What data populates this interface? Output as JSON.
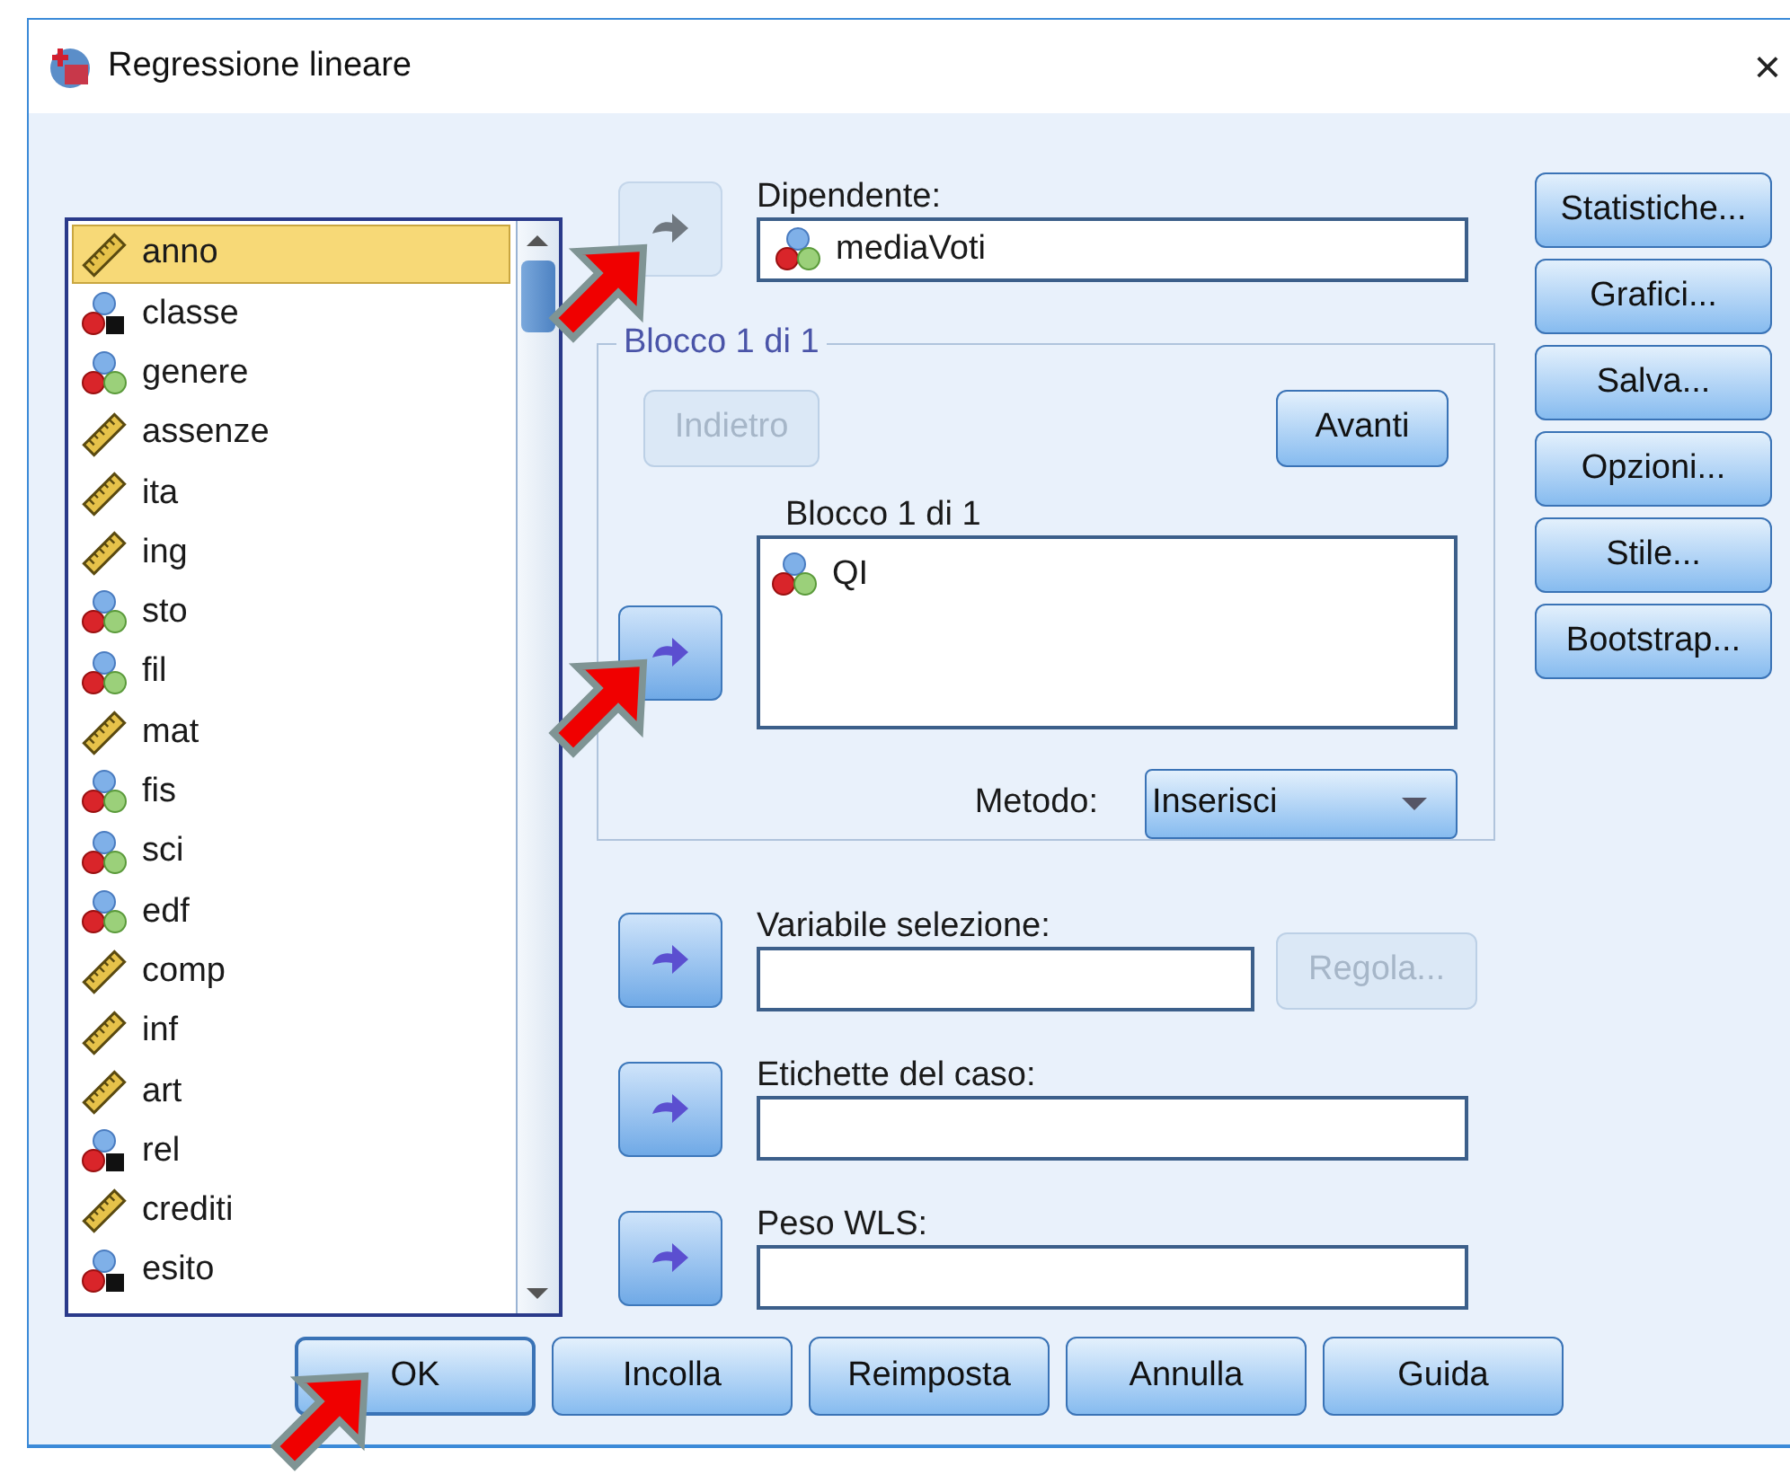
{
  "window": {
    "title": "Regressione lineare",
    "close": "×"
  },
  "variables": [
    {
      "name": "anno",
      "kind": "scale",
      "selected": true
    },
    {
      "name": "classe",
      "kind": "nominal_string",
      "selected": false
    },
    {
      "name": "genere",
      "kind": "nominal",
      "selected": false
    },
    {
      "name": "assenze",
      "kind": "scale",
      "selected": false
    },
    {
      "name": "ita",
      "kind": "scale",
      "selected": false
    },
    {
      "name": "ing",
      "kind": "scale",
      "selected": false
    },
    {
      "name": "sto",
      "kind": "nominal",
      "selected": false
    },
    {
      "name": "fil",
      "kind": "nominal",
      "selected": false
    },
    {
      "name": "mat",
      "kind": "scale",
      "selected": false
    },
    {
      "name": "fis",
      "kind": "nominal",
      "selected": false
    },
    {
      "name": "sci",
      "kind": "nominal",
      "selected": false
    },
    {
      "name": "edf",
      "kind": "nominal",
      "selected": false
    },
    {
      "name": "comp",
      "kind": "scale",
      "selected": false
    },
    {
      "name": "inf",
      "kind": "scale",
      "selected": false
    },
    {
      "name": "art",
      "kind": "scale",
      "selected": false
    },
    {
      "name": "rel",
      "kind": "nominal_string",
      "selected": false
    },
    {
      "name": "crediti",
      "kind": "scale",
      "selected": false
    },
    {
      "name": "esito",
      "kind": "nominal_string",
      "selected": false
    }
  ],
  "dependent": {
    "label": "Dipendente:",
    "value": {
      "name": "mediaVoti",
      "kind": "nominal"
    },
    "arrow_disabled": true
  },
  "block": {
    "legend": "Blocco 1 di 1",
    "back": {
      "label": "Indietro",
      "disabled": true
    },
    "next": {
      "label": "Avanti",
      "disabled": false
    },
    "list_label": "Blocco 1 di 1",
    "independents": [
      {
        "name": "QI",
        "kind": "nominal"
      }
    ],
    "arrow_disabled": false,
    "method_label": "Metodo:",
    "method_value": "Inserisci"
  },
  "selection": {
    "label": "Variabile selezione:",
    "arrow_disabled": false,
    "rule": {
      "label": "Regola...",
      "disabled": true
    }
  },
  "case_labels": {
    "label": "Etichette del caso:",
    "arrow_disabled": false
  },
  "wls": {
    "label": "Peso WLS:",
    "arrow_disabled": false
  },
  "side_buttons": [
    "Statistiche...",
    "Grafici...",
    "Salva...",
    "Opzioni...",
    "Stile...",
    "Bootstrap..."
  ],
  "bottom_buttons": [
    {
      "label": "OK",
      "default": true
    },
    {
      "label": "Incolla",
      "default": false
    },
    {
      "label": "Reimposta",
      "default": false
    },
    {
      "label": "Annulla",
      "default": false
    },
    {
      "label": "Guida",
      "default": false
    }
  ]
}
